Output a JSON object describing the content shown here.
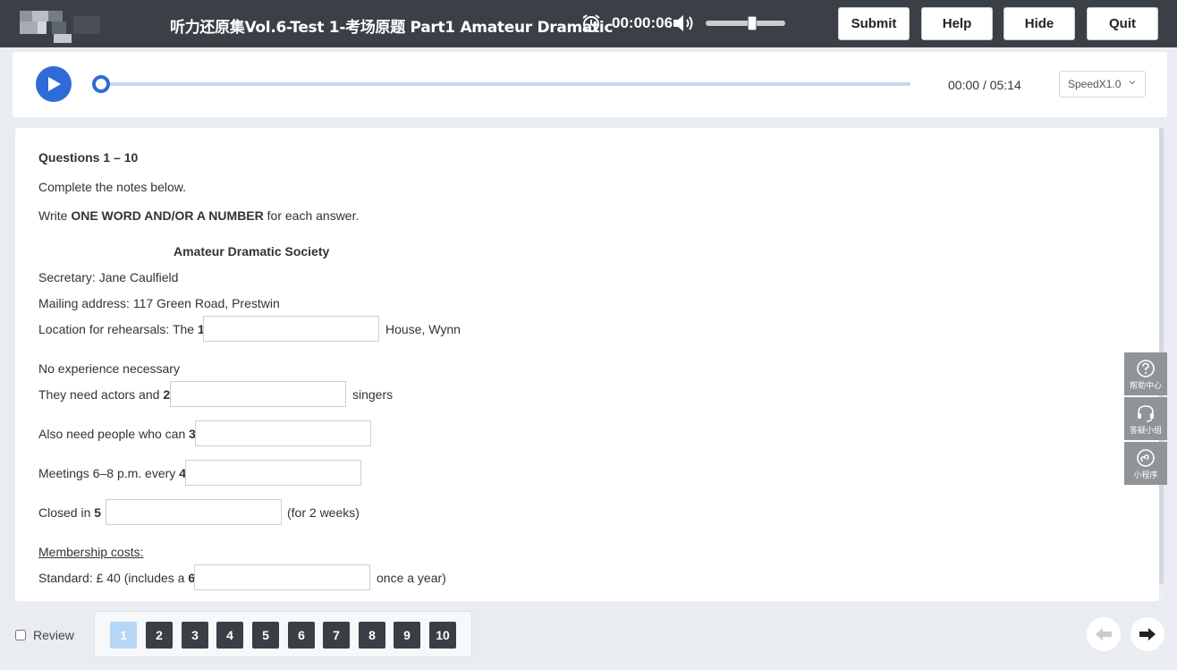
{
  "header": {
    "title": "听力还原集Vol.6-Test 1-考场原题 Part1 Amateur Dramatic",
    "timer": "00:00:06",
    "volume_level": 0.6,
    "buttons": {
      "submit": "Submit",
      "help": "Help",
      "hide": "Hide",
      "quit": "Quit"
    }
  },
  "player": {
    "current": "00:00",
    "separator": "/",
    "total": "05:14",
    "progress": 0,
    "speed": "SpeedX1.0"
  },
  "content": {
    "questions_range": "Questions 1 – 10",
    "instruction1": "Complete the notes below.",
    "instruction2_pre": "Write ",
    "instruction2_bold": "ONE WORD AND/OR A NUMBER",
    "instruction2_post": " for each answer.",
    "heading": "Amateur Dramatic Society",
    "secretary": "Secretary: Jane Caulfield",
    "mailing": "Mailing address: 117 Green Road, Prestwin",
    "q1_pre": "Location for rehearsals: The ",
    "q1_num": "1",
    "q1_post": "House, Wynn",
    "no_experience": "No experience necessary",
    "q2_pre": "They need actors and ",
    "q2_num": "2",
    "q2_post": "singers",
    "q3_pre": "Also need people who can ",
    "q3_num": "3",
    "q4_pre": "Meetings 6–8 p.m. every ",
    "q4_num": "4",
    "q5_pre": "Closed in ",
    "q5_num": "5",
    "q5_post": "(for 2 weeks)",
    "membership": "Membership costs:",
    "q6_pre": "Standard: £ 40 (includes a ",
    "q6_num": "6",
    "q6_post": "once a year)",
    "answers": [
      "",
      "",
      "",
      "",
      "",
      ""
    ]
  },
  "side_tools": [
    {
      "icon": "question-circle-icon",
      "label": "帮助中心"
    },
    {
      "icon": "headset-icon",
      "label": "答疑小组"
    },
    {
      "icon": "mini-program-icon",
      "label": "小程序"
    }
  ],
  "footer": {
    "review_label": "Review",
    "question_numbers": [
      "1",
      "2",
      "3",
      "4",
      "5",
      "6",
      "7",
      "8",
      "9",
      "10"
    ],
    "active_question": "1"
  },
  "colors": {
    "topbar": "#3b3f46",
    "accent": "#2f6bd8",
    "active_question": "#b7d6f5"
  }
}
